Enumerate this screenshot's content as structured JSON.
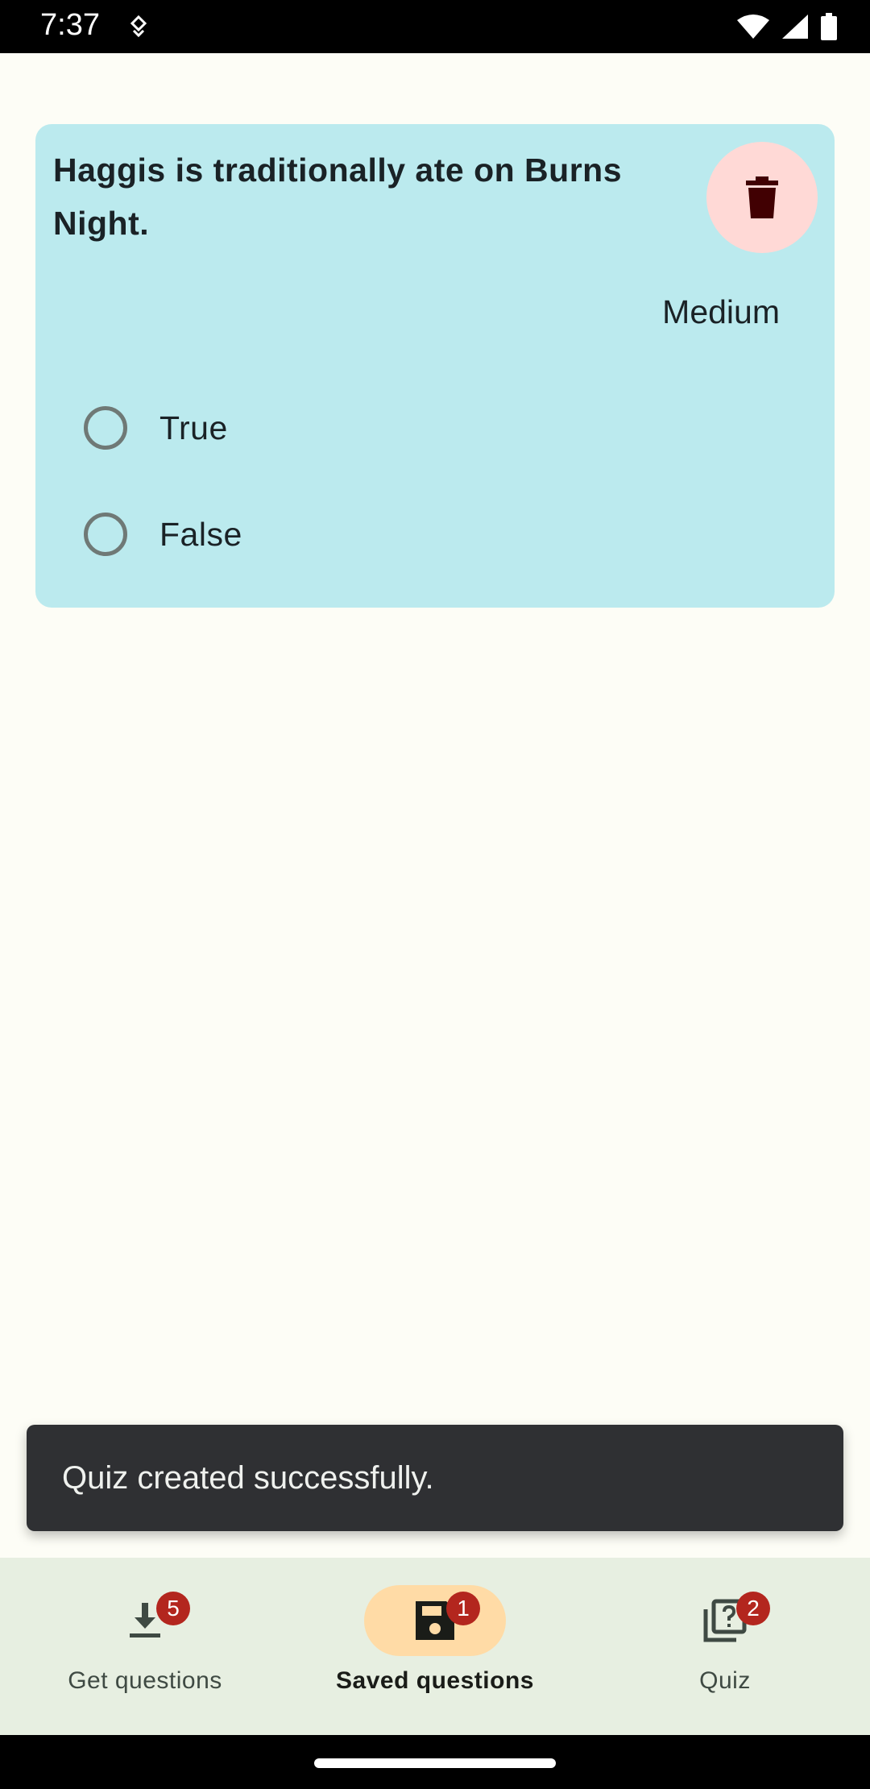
{
  "status_bar": {
    "time": "7:37"
  },
  "card": {
    "question": "Haggis is traditionally ate on Burns Night.",
    "difficulty": "Medium",
    "options": [
      {
        "label": "True",
        "selected": false
      },
      {
        "label": "False",
        "selected": false
      }
    ]
  },
  "snackbar": {
    "message": "Quiz created successfully."
  },
  "bottom_nav": {
    "items": [
      {
        "label": "Get questions",
        "badge": "5",
        "icon": "download-icon",
        "active": false
      },
      {
        "label": "Saved questions",
        "badge": "1",
        "icon": "save-icon",
        "active": true
      },
      {
        "label": "Quiz",
        "badge": "2",
        "icon": "quiz-icon",
        "active": false
      }
    ]
  },
  "colors": {
    "card_bg": "#bbeaee",
    "delete_bg": "#ffd9d6",
    "delete_icon": "#410002",
    "active_indicator": "#ffdba6",
    "badge": "#b3261e",
    "snackbar_bg": "#2f3033",
    "nav_bg": "#e7efe1"
  }
}
